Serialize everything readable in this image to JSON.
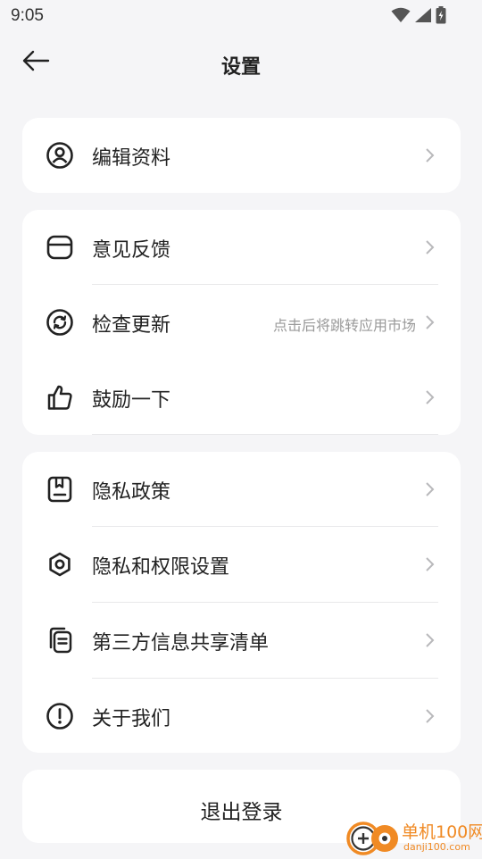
{
  "status_bar": {
    "time": "9:05",
    "icons": [
      "wifi-icon",
      "cellular-signal-icon",
      "battery-charging-icon"
    ]
  },
  "header": {
    "title": "设置",
    "back_icon": "back-arrow-icon"
  },
  "groups": [
    {
      "items": [
        {
          "label": "编辑资料",
          "icon": "user-profile-icon"
        }
      ]
    },
    {
      "items": [
        {
          "label": "意见反馈",
          "icon": "feedback-icon"
        },
        {
          "label": "检查更新",
          "icon": "refresh-icon",
          "hint": "点击后将跳转应用市场"
        },
        {
          "label": "鼓励一下",
          "icon": "thumbs-up-icon"
        }
      ]
    },
    {
      "items": [
        {
          "label": "隐私政策",
          "icon": "privacy-document-icon"
        },
        {
          "label": "隐私和权限设置",
          "icon": "gear-icon"
        },
        {
          "label": "第三方信息共享清单",
          "icon": "copy-list-icon"
        },
        {
          "label": "关于我们",
          "icon": "info-icon"
        }
      ]
    }
  ],
  "logout": {
    "label": "退出登录"
  },
  "watermark": {
    "name": "单机100网",
    "url": "danji100.com"
  },
  "colors": {
    "background": "#f5f5f7",
    "card": "#ffffff",
    "text": "#222222",
    "hint": "#999999",
    "chevron": "#b8b8bb",
    "watermark": "#f08a24"
  }
}
